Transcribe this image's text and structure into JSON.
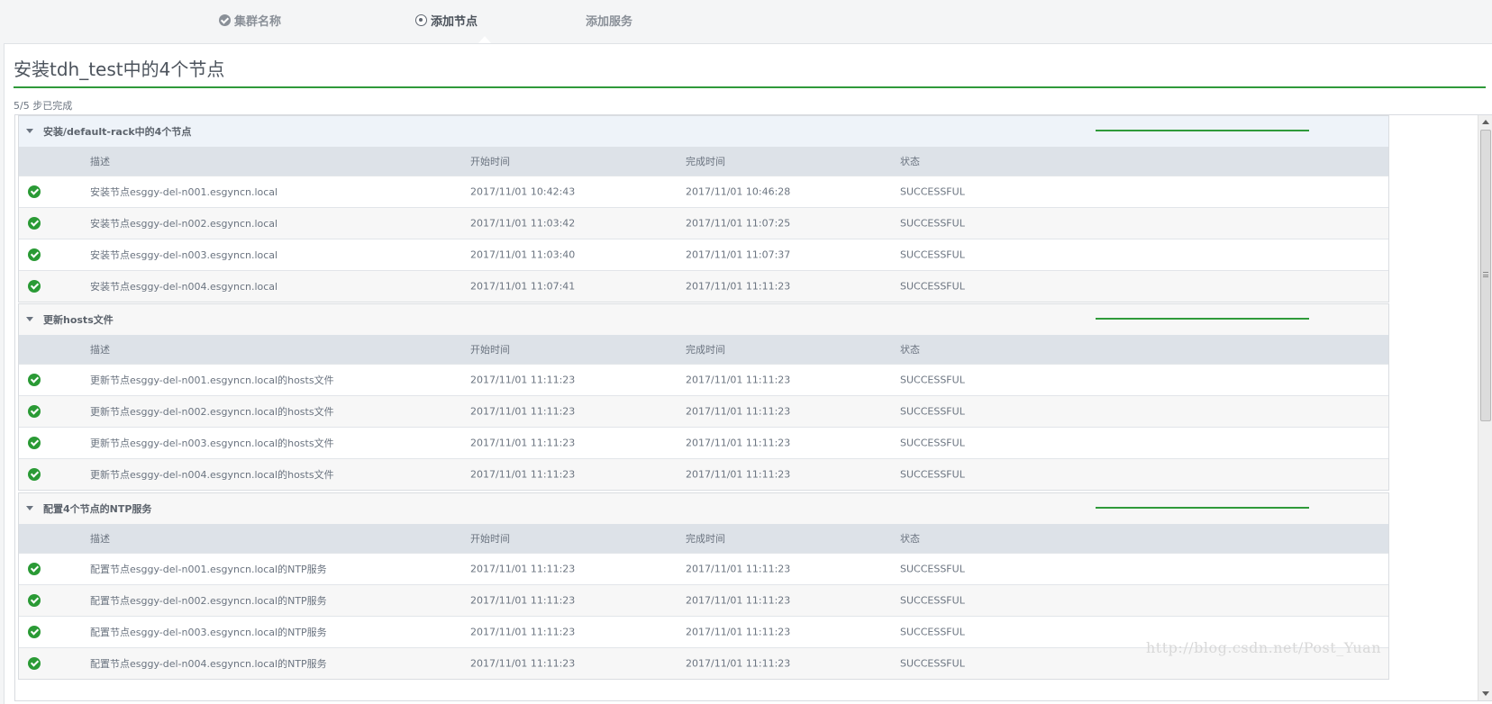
{
  "wizard": {
    "steps": [
      {
        "label": "集群名称",
        "state": "done"
      },
      {
        "label": "添加节点",
        "state": "current"
      },
      {
        "label": "添加服务",
        "state": "pending"
      }
    ]
  },
  "page": {
    "title": "安装tdh_test中的4个节点",
    "progress": "5/5 步已完成"
  },
  "columns": {
    "desc": "描述",
    "start": "开始时间",
    "end": "完成时间",
    "status": "状态"
  },
  "sections": [
    {
      "title": "安装/default-rack中的4个节点",
      "rows": [
        {
          "desc": "安装节点esggy-del-n001.esgyncn.local",
          "start": "2017/11/01 10:42:43",
          "end": "2017/11/01 10:46:28",
          "status": "SUCCESSFUL"
        },
        {
          "desc": "安装节点esggy-del-n002.esgyncn.local",
          "start": "2017/11/01 11:03:42",
          "end": "2017/11/01 11:07:25",
          "status": "SUCCESSFUL"
        },
        {
          "desc": "安装节点esggy-del-n003.esgyncn.local",
          "start": "2017/11/01 11:03:40",
          "end": "2017/11/01 11:07:37",
          "status": "SUCCESSFUL"
        },
        {
          "desc": "安装节点esggy-del-n004.esgyncn.local",
          "start": "2017/11/01 11:07:41",
          "end": "2017/11/01 11:11:23",
          "status": "SUCCESSFUL"
        }
      ]
    },
    {
      "title": "更新hosts文件",
      "rows": [
        {
          "desc": "更新节点esggy-del-n001.esgyncn.local的hosts文件",
          "start": "2017/11/01 11:11:23",
          "end": "2017/11/01 11:11:23",
          "status": "SUCCESSFUL"
        },
        {
          "desc": "更新节点esggy-del-n002.esgyncn.local的hosts文件",
          "start": "2017/11/01 11:11:23",
          "end": "2017/11/01 11:11:23",
          "status": "SUCCESSFUL"
        },
        {
          "desc": "更新节点esggy-del-n003.esgyncn.local的hosts文件",
          "start": "2017/11/01 11:11:23",
          "end": "2017/11/01 11:11:23",
          "status": "SUCCESSFUL"
        },
        {
          "desc": "更新节点esggy-del-n004.esgyncn.local的hosts文件",
          "start": "2017/11/01 11:11:23",
          "end": "2017/11/01 11:11:23",
          "status": "SUCCESSFUL"
        }
      ]
    },
    {
      "title": "配置4个节点的NTP服务",
      "rows": [
        {
          "desc": "配置节点esggy-del-n001.esgyncn.local的NTP服务",
          "start": "2017/11/01 11:11:23",
          "end": "2017/11/01 11:11:23",
          "status": "SUCCESSFUL"
        },
        {
          "desc": "配置节点esggy-del-n002.esgyncn.local的NTP服务",
          "start": "2017/11/01 11:11:23",
          "end": "2017/11/01 11:11:23",
          "status": "SUCCESSFUL"
        },
        {
          "desc": "配置节点esggy-del-n003.esgyncn.local的NTP服务",
          "start": "2017/11/01 11:11:23",
          "end": "2017/11/01 11:11:23",
          "status": "SUCCESSFUL"
        },
        {
          "desc": "配置节点esggy-del-n004.esgyncn.local的NTP服务",
          "start": "2017/11/01 11:11:23",
          "end": "2017/11/01 11:11:23",
          "status": "SUCCESSFUL"
        }
      ]
    }
  ],
  "watermark": "http://blog.csdn.net/Post_Yuan",
  "colors": {
    "accent_green": "#2f9a3a",
    "success_icon": "#2a9a35",
    "header_bg": "#dde2e8"
  }
}
